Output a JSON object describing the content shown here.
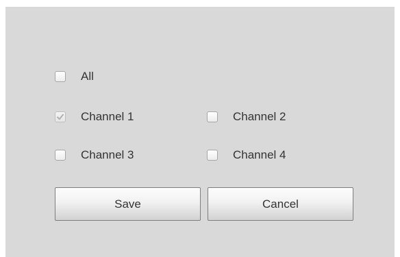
{
  "options": {
    "all": {
      "label": "All",
      "checked": false,
      "disabled": false
    },
    "channels": [
      {
        "label": "Channel 1",
        "checked": true,
        "disabled": true
      },
      {
        "label": "Channel 2",
        "checked": false,
        "disabled": false
      },
      {
        "label": "Channel 3",
        "checked": false,
        "disabled": false
      },
      {
        "label": "Channel 4",
        "checked": false,
        "disabled": false
      }
    ]
  },
  "buttons": {
    "save_label": "Save",
    "cancel_label": "Cancel"
  },
  "icons": {
    "check": "check-icon"
  },
  "colors": {
    "panel_background": "#d9d9d9",
    "text": "#333333",
    "check_mark_disabled": "#b0b0b0"
  }
}
